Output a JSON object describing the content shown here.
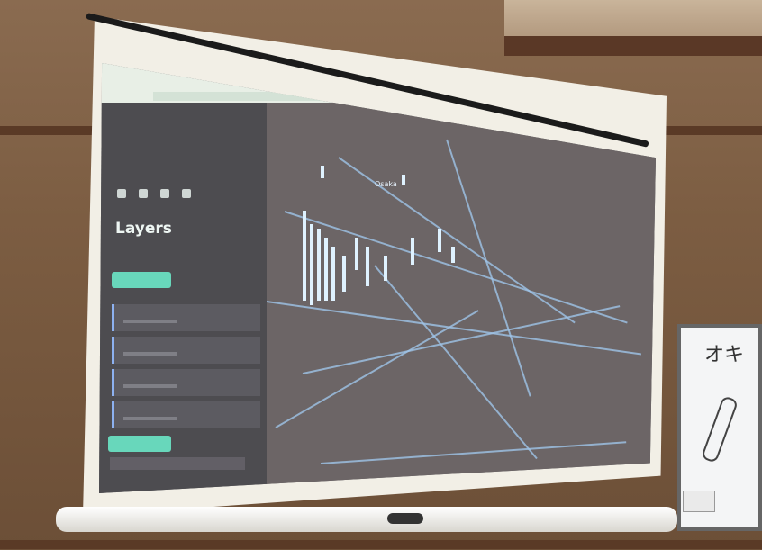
{
  "scene": {
    "colors": {
      "wall": "#7c5d42",
      "screen": "#f2efe6",
      "ui_dark": "#4d4c50",
      "accent": "#68d7bb",
      "map_lines": "#9fc4e8"
    }
  },
  "projected_ui": {
    "sidebar": {
      "title": "Layers",
      "nav_icons": [
        "layers-icon",
        "filter-icon",
        "interaction-icon",
        "map-icon"
      ],
      "layer_count": 4,
      "buttons": [
        "add-data-button",
        "add-layer-button"
      ]
    },
    "map": {
      "city_label": "Osaka"
    }
  },
  "whiteboard": {
    "text": "オキ"
  }
}
